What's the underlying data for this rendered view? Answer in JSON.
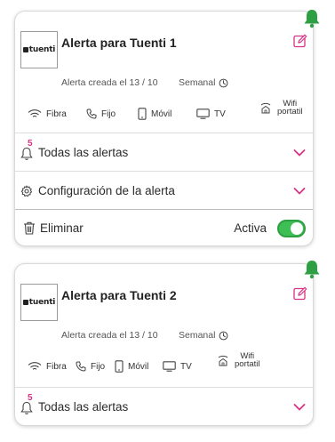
{
  "colors": {
    "accent": "#d63384",
    "bell": "#2ea043",
    "toggle_on": "#3dbf55"
  },
  "alerts": [
    {
      "logo_text": "tuenti",
      "title": "Alerta para Tuenti 1",
      "created": "Alerta creada el 13 / 10",
      "frequency": "Semanal",
      "services": {
        "fibra": "Fibra",
        "fijo": "Fijo",
        "movil": "Móvil",
        "tv": "TV",
        "wifi_line1": "Wifi",
        "wifi_line2": "portatil"
      },
      "all_alerts_label": "Todas las alertas",
      "all_alerts_count": "5",
      "config_label": "Configuración de la alerta",
      "delete_label": "Eliminar",
      "active_label": "Activa",
      "active": true
    },
    {
      "logo_text": "tuenti",
      "title": "Alerta para Tuenti 2",
      "created": "Alerta creada el 13 / 10",
      "frequency": "Semanal",
      "services": {
        "fibra": "Fibra",
        "fijo": "Fijo",
        "movil": "Móvil",
        "tv": "TV",
        "wifi_line1": "Wifi",
        "wifi_line2": "portatil"
      },
      "all_alerts_label": "Todas las alertas",
      "all_alerts_count": "5"
    }
  ]
}
